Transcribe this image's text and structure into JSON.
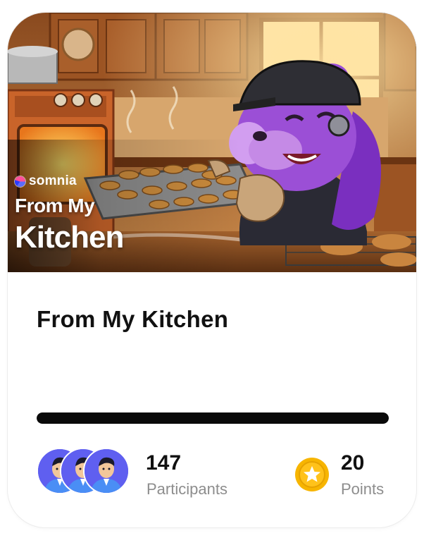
{
  "banner": {
    "brand": "somnia",
    "title_line1": "From My",
    "title_line2": "Kitchen"
  },
  "card": {
    "title": "From My Kitchen",
    "progress_fraction": 1.0
  },
  "stats": {
    "participants_count": "147",
    "participants_label": "Participants",
    "points_value": "20",
    "points_label": "Points"
  },
  "icons": {
    "brand": "somnia-logo-icon",
    "participants": "user-avatar-icon",
    "points": "star-coin-icon"
  },
  "colors": {
    "progress": "#0a0a0a",
    "coin": "#f7b500",
    "avatar_bg": "#5f5ff0",
    "mascot": "#9b4fd6"
  }
}
